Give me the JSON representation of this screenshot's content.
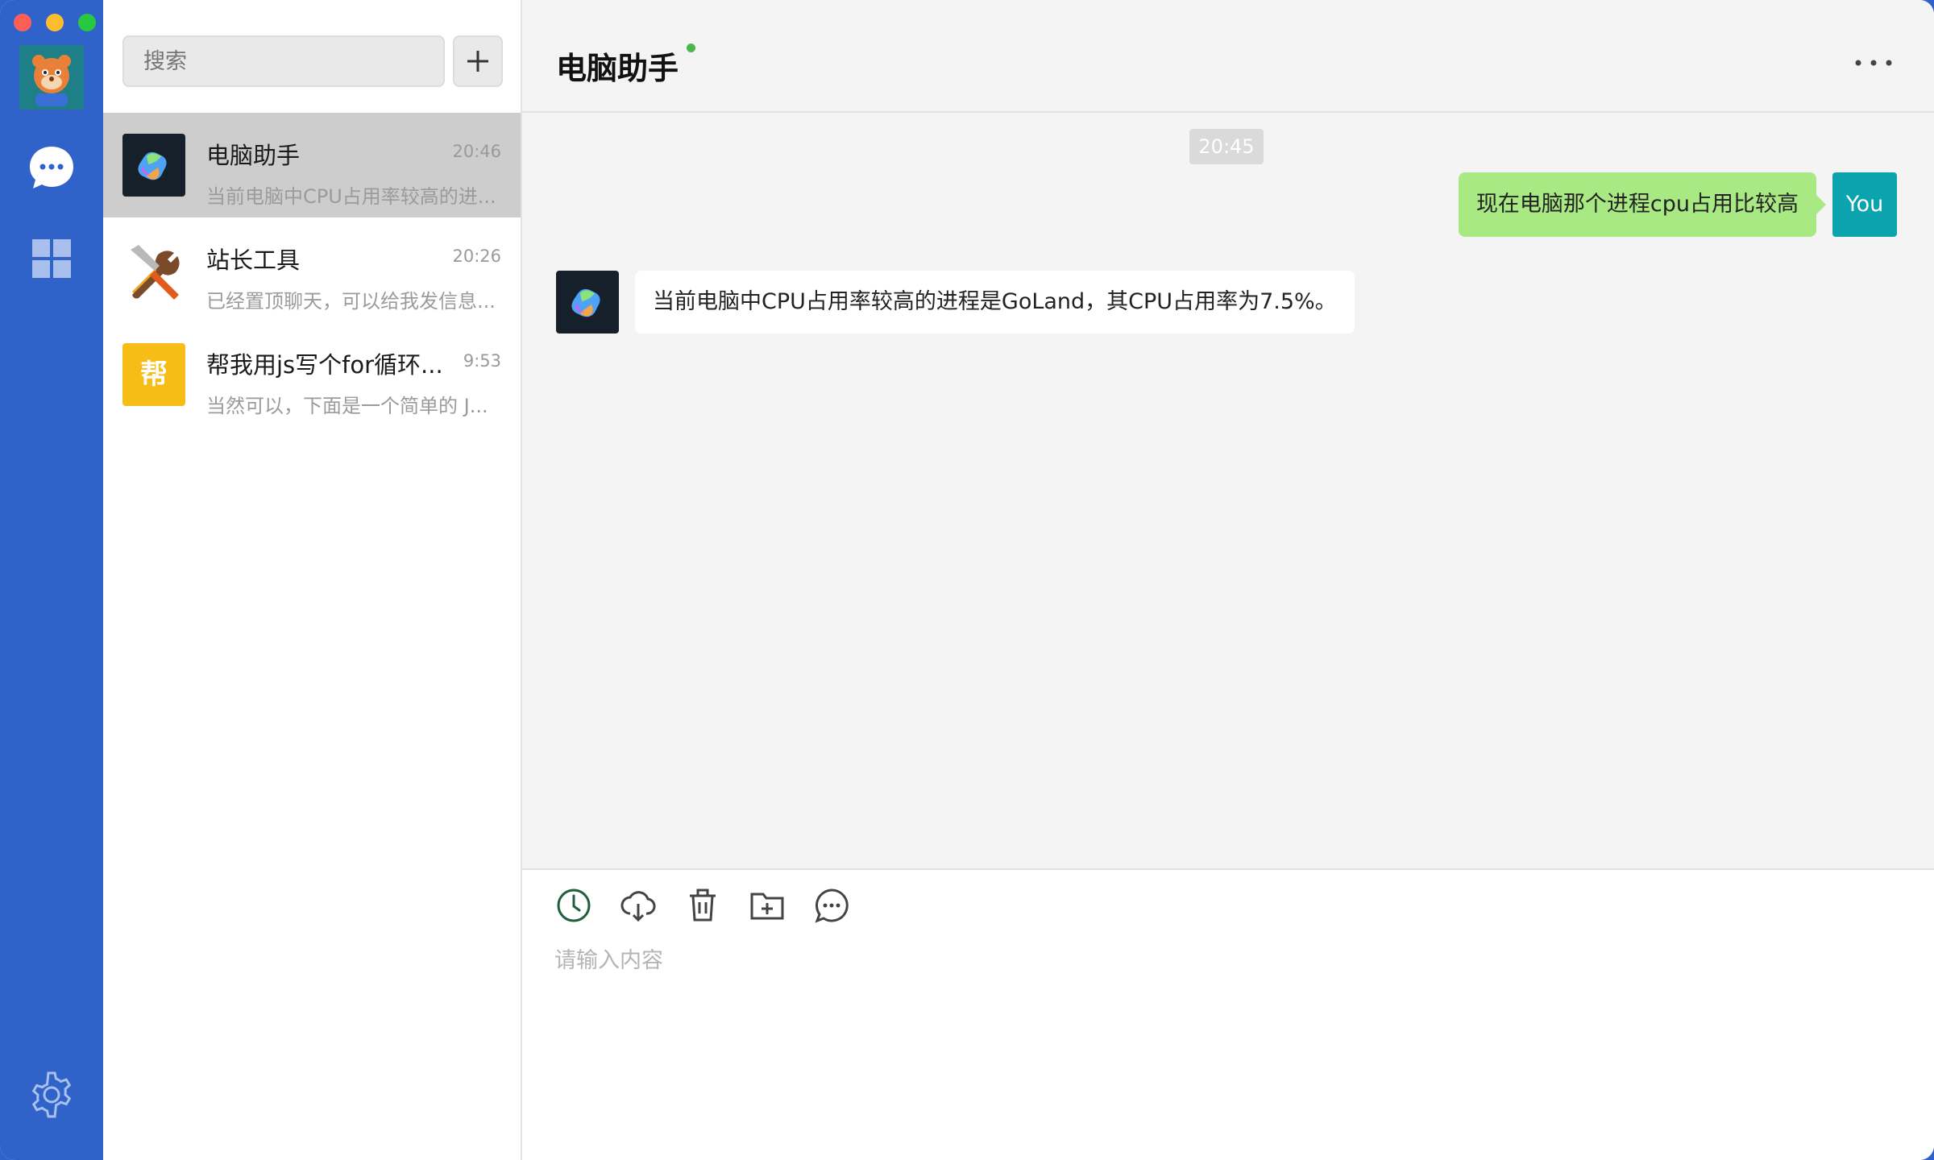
{
  "colors": {
    "rail": "#2f63c9",
    "active_item": "#cdcdcd",
    "outgoing_bubble": "#a9e983",
    "you_avatar": "#0aa3ae",
    "online": "#4cb74a"
  },
  "rail": {
    "icons": [
      "chat-bubble-icon",
      "apps-grid-icon",
      "settings-gear-icon"
    ]
  },
  "search": {
    "placeholder": "搜索"
  },
  "conversations": [
    {
      "name": "电脑助手",
      "time": "20:46",
      "preview": "当前电脑中CPU占用率较高的进...",
      "avatar": "copilot-logo"
    },
    {
      "name": "站长工具",
      "time": "20:26",
      "preview": "已经置顶聊天，可以给我发信息...",
      "avatar": "tools-icon"
    },
    {
      "name": "帮我用js写个for循环...",
      "time": "9:53",
      "preview": "当然可以，下面是一个简单的 J...",
      "avatar_text": "帮"
    }
  ],
  "chat": {
    "title": "电脑助手",
    "time_divider": "20:45",
    "messages": [
      {
        "from": "You",
        "text": "现在电脑那个进程cpu占用比较高"
      },
      {
        "from": "电脑助手",
        "text": "当前电脑中CPU占用率较高的进程是GoLand，其CPU占用率为7.5%。"
      }
    ]
  },
  "composer": {
    "placeholder": "请输入内容",
    "tools": [
      "clock-icon",
      "cloud-download-icon",
      "trash-icon",
      "folder-add-icon",
      "message-more-icon"
    ]
  }
}
